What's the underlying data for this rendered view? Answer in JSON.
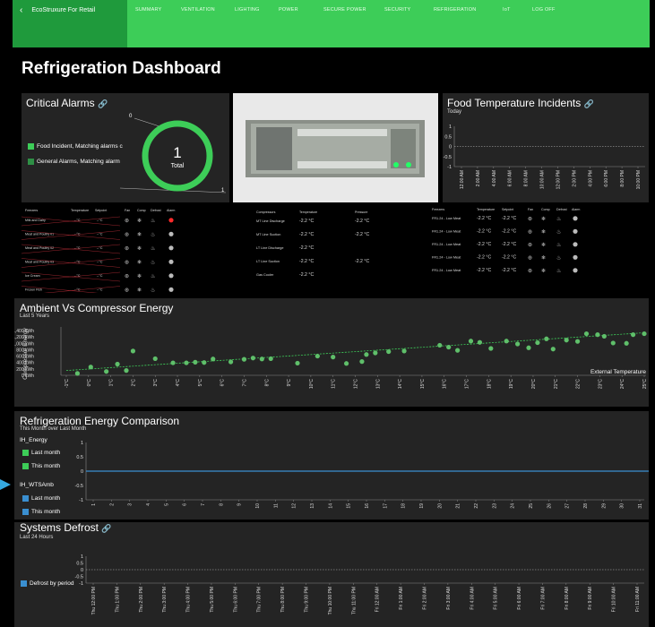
{
  "nav": {
    "home": "EcoStruxure For Retail",
    "items": [
      "SUMMARY",
      "VENTILATION",
      "LIGHTING",
      "POWER",
      "SECURE POWER",
      "SECURITY",
      "REFRIGERATION",
      "IoT",
      "LOG OFF"
    ]
  },
  "page_title": "Refrigeration Dashboard",
  "critical_alarms": {
    "title": "Critical Alarms",
    "legend": [
      "Food Incident, Matching alarms c",
      "General Alarms, Matching alarm"
    ],
    "total_value": "1",
    "total_label": "Total",
    "scale_min": "0",
    "scale_max": "1"
  },
  "food_temp": {
    "title": "Food Temperature Incidents",
    "subtitle": "Today",
    "y_ticks": [
      "1",
      "0.5",
      "0",
      "-0.5",
      "-1"
    ],
    "x_ticks": [
      "12:00 AM",
      "2:00 AM",
      "4:00 AM",
      "6:00 AM",
      "8:00 AM",
      "10:00 AM",
      "12:00 PM",
      "2:00 PM",
      "4:00 PM",
      "6:00 PM",
      "8:00 PM",
      "10:00 PM"
    ]
  },
  "cases_table": {
    "headers": [
      "Freezers",
      "Temperature",
      "Setpoint",
      "Fan",
      "Comp",
      "Defrost",
      "Alarm"
    ],
    "rows": [
      {
        "name": "Milk and Dairy",
        "temp": "--°C",
        "set": "--°C",
        "alarm": "#ff2a2a"
      },
      {
        "name": "Meat and Poultry 01",
        "temp": "--°C",
        "set": "--°C",
        "alarm": "#bbbbbb"
      },
      {
        "name": "Meat and Poultry 02",
        "temp": "--°C",
        "set": "--°C",
        "alarm": "#bbbbbb"
      },
      {
        "name": "Meat and Poultry 03",
        "temp": "--°C",
        "set": "--°C",
        "alarm": "#bbbbbb"
      },
      {
        "name": "Ice Cream",
        "temp": "--°C",
        "set": "--°C",
        "alarm": "#bbbbbb"
      },
      {
        "name": "Frozen Fish",
        "temp": "--°C",
        "set": "--°C",
        "alarm": "#bbbbbb"
      }
    ]
  },
  "compressors_table": {
    "headers": [
      "Compressors",
      "Temperature",
      "Pressure"
    ],
    "rows": [
      {
        "name": "MT Line Discharge",
        "temp": "-2.2 °C",
        "pressure": "-2.2 °C"
      },
      {
        "name": "MT Line Suction",
        "temp": "-2.2 °C",
        "pressure": "-2.2 °C"
      },
      {
        "name": "LT Line Discharge",
        "temp": "-2.2 °C",
        "pressure": ""
      },
      {
        "name": "LT Line Suction",
        "temp": "-2.2 °C",
        "pressure": "-2.2 °C"
      },
      {
        "name": "Gas Cooler",
        "temp": "-2.2 °C",
        "pressure": ""
      }
    ]
  },
  "freezers_table": {
    "headers": [
      "Freezers",
      "Temperature",
      "Setpoint",
      "Fan",
      "Comp",
      "Defrost",
      "Alarm"
    ],
    "rows": [
      {
        "name": "FR1.24 - Low Meat",
        "temp": "-2.2 °C",
        "set": "-2.2 °C"
      },
      {
        "name": "FR1.24 - Low Meat",
        "temp": "-2.2 °C",
        "set": "-2.2 °C"
      },
      {
        "name": "FR1.24 - Low Meat",
        "temp": "-2.2 °C",
        "set": "-2.2 °C"
      },
      {
        "name": "FR1.24 - Low Meat",
        "temp": "-2.2 °C",
        "set": "-2.2 °C"
      },
      {
        "name": "FR1.24 - Low Meat",
        "temp": "-2.2 °C",
        "set": "-2.2 °C"
      }
    ]
  },
  "ambient": {
    "title": "Ambient Vs Compressor Energy",
    "subtitle": "Last 5 Years",
    "ylabel": "Compressor Energy",
    "xlabel": "External Temperature",
    "y_ticks": [
      "1,400 kWh",
      "1,200 kWh",
      "1,000 kWh",
      "800 kWh",
      "600 kWh",
      "400 kWh",
      "200 kWh",
      "0 kWh"
    ],
    "x_ticks": [
      "-1°C",
      "0°C",
      "1°C",
      "2°C",
      "3°C",
      "4°C",
      "5°C",
      "6°C",
      "7°C",
      "8°C",
      "9°C",
      "10°C",
      "11°C",
      "12°C",
      "13°C",
      "14°C",
      "15°C",
      "16°C",
      "17°C",
      "18°C",
      "19°C",
      "20°C",
      "21°C",
      "22°C",
      "23°C",
      "24°C",
      "25°C"
    ]
  },
  "chart_data": [
    {
      "type": "scatter",
      "title": "Ambient Vs Compressor Energy",
      "xlabel": "External Temperature",
      "ylabel": "Compressor Energy",
      "xlim": [
        -1,
        25
      ],
      "ylim": [
        0,
        1400
      ],
      "series": [
        {
          "values": [
            [
              -0.5,
              60
            ],
            [
              0.1,
              260
            ],
            [
              0.8,
              120
            ],
            [
              1.3,
              350
            ],
            [
              1.7,
              150
            ],
            [
              2.0,
              760
            ],
            [
              3.0,
              520
            ],
            [
              3.8,
              390
            ],
            [
              4.4,
              390
            ],
            [
              4.8,
              410
            ],
            [
              5.2,
              400
            ],
            [
              5.6,
              510
            ],
            [
              6.4,
              420
            ],
            [
              7.0,
              500
            ],
            [
              7.4,
              540
            ],
            [
              7.8,
              510
            ],
            [
              8.2,
              520
            ],
            [
              9.4,
              380
            ],
            [
              10.3,
              600
            ],
            [
              11.0,
              570
            ],
            [
              11.6,
              370
            ],
            [
              12.3,
              430
            ],
            [
              12.5,
              650
            ],
            [
              12.9,
              700
            ],
            [
              13.5,
              740
            ],
            [
              14.2,
              760
            ],
            [
              15.8,
              940
            ],
            [
              16.2,
              880
            ],
            [
              16.6,
              780
            ],
            [
              17.2,
              1070
            ],
            [
              17.6,
              1030
            ],
            [
              18.1,
              840
            ],
            [
              18.8,
              1070
            ],
            [
              19.3,
              980
            ],
            [
              19.8,
              860
            ],
            [
              20.2,
              1020
            ],
            [
              20.6,
              1140
            ],
            [
              20.9,
              820
            ],
            [
              21.5,
              1100
            ],
            [
              22.0,
              1060
            ],
            [
              22.4,
              1300
            ],
            [
              22.9,
              1270
            ],
            [
              23.2,
              1220
            ],
            [
              23.6,
              1010
            ],
            [
              24.2,
              1000
            ],
            [
              24.5,
              1270
            ],
            [
              25.0,
              1300
            ]
          ]
        }
      ],
      "trendline": [
        [
          -1,
          150
        ],
        [
          25,
          1330
        ]
      ]
    },
    {
      "type": "line",
      "title": "Refrigeration Energy Comparison",
      "subtitle": "This Month over Last Month",
      "ylim": [
        -1,
        1
      ],
      "x": [
        1,
        2,
        3,
        4,
        5,
        6,
        7,
        8,
        9,
        10,
        11,
        12,
        13,
        14,
        15,
        16,
        17,
        18,
        19,
        20,
        21,
        22,
        23,
        24,
        25,
        26,
        27,
        28,
        29,
        30,
        31
      ],
      "series": [
        {
          "name": "IH_Energy Last month",
          "values": [
            0,
            0,
            0,
            0,
            0,
            0,
            0,
            0,
            0,
            0,
            0,
            0,
            0,
            0,
            0,
            0,
            0,
            0,
            0,
            0,
            0,
            0,
            0,
            0,
            0,
            0,
            0,
            0,
            0,
            0,
            0
          ]
        }
      ]
    }
  ],
  "energy_compare": {
    "title": "Refrigeration Energy Comparison",
    "subtitle": "This Month over Last Month",
    "group1": "IH_Energy",
    "group2": "IH_WTSAmb",
    "last": "Last month",
    "this": "This month",
    "y_ticks": [
      "1",
      "0.5",
      "0",
      "-0.5",
      "-1"
    ],
    "x_ticks": [
      "1",
      "2",
      "3",
      "4",
      "5",
      "6",
      "7",
      "8",
      "9",
      "10",
      "11",
      "12",
      "13",
      "14",
      "15",
      "16",
      "17",
      "18",
      "19",
      "20",
      "21",
      "22",
      "23",
      "24",
      "25",
      "26",
      "27",
      "28",
      "29",
      "30",
      "31"
    ]
  },
  "defrost": {
    "title": "Systems Defrost",
    "subtitle": "Last 24 Hours",
    "legend": "Defrost by period",
    "y_ticks": [
      "1",
      "0.5",
      "0",
      "-0.5",
      "-1"
    ],
    "x_ticks": [
      "Thu 12:00 PM",
      "Thu 1:00 PM",
      "Thu 2:00 PM",
      "Thu 3:00 PM",
      "Thu 4:00 PM",
      "Thu 5:00 PM",
      "Thu 6:00 PM",
      "Thu 7:00 PM",
      "Thu 8:00 PM",
      "Thu 9:00 PM",
      "Thu 10:00 PM",
      "Thu 11:00 PM",
      "Fri 12:00 AM",
      "Fri 1:00 AM",
      "Fri 2:00 AM",
      "Fri 3:00 AM",
      "Fri 4:00 AM",
      "Fri 5:00 AM",
      "Fri 6:00 AM",
      "Fri 7:00 AM",
      "Fri 8:00 AM",
      "Fri 9:00 AM",
      "Fri 10:00 AM",
      "Fri 11:00 AM"
    ]
  },
  "colors": {
    "accent": "#3dcd58",
    "nav_dark": "#1f9a3c",
    "panel": "#242424",
    "series_blue": "#3a8fd0"
  },
  "icons": {
    "back": "chevron-left-icon",
    "link": "link-icon",
    "fan": "fan-icon",
    "comp": "snowflake-icon",
    "defrost": "defrost-icon"
  }
}
